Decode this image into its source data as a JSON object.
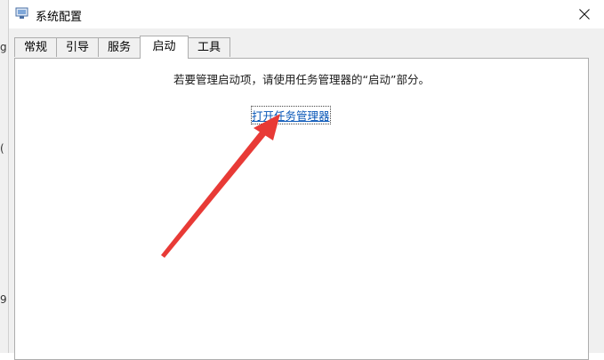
{
  "window": {
    "title": "系统配置",
    "app_icon": "msconfig-icon",
    "close_icon": "close-icon"
  },
  "tabs": [
    {
      "label": "常规",
      "active": false
    },
    {
      "label": "引导",
      "active": false
    },
    {
      "label": "服务",
      "active": false
    },
    {
      "label": "启动",
      "active": true
    },
    {
      "label": "工具",
      "active": false
    }
  ],
  "startup_panel": {
    "instruction": "若要管理启动项，请使用任务管理器的“启动”部分。",
    "open_task_manager_link": "打开任务管理器"
  },
  "background_window": {
    "glyphs": [
      "g",
      "(",
      "9"
    ]
  },
  "colors": {
    "link": "#0b58b8",
    "annotation_arrow": "#e83a36",
    "panel_border": "#adadad"
  }
}
